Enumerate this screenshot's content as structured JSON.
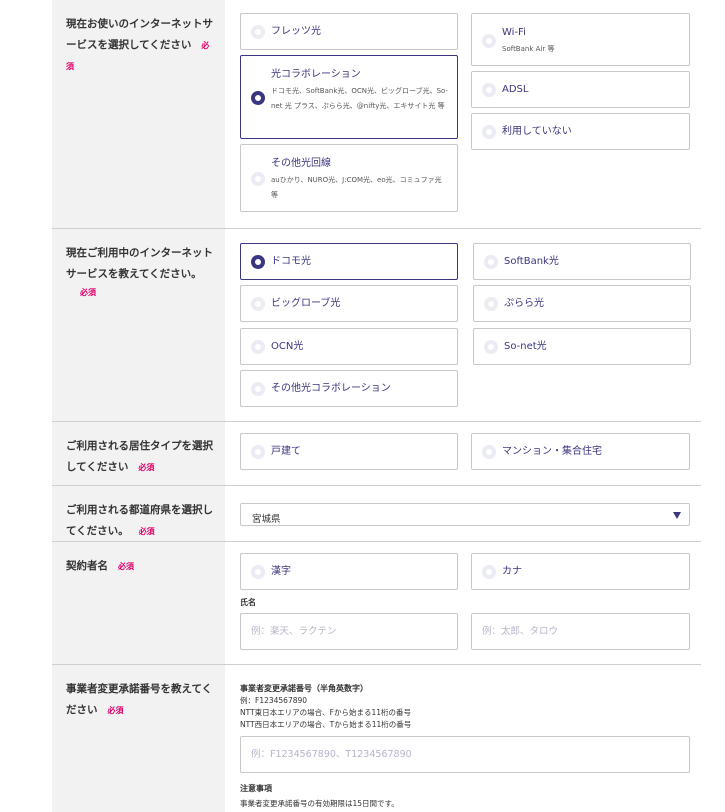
{
  "q1": {
    "label": "現在お使いのインターネットサービスを選択してください",
    "required": "必須",
    "options": [
      {
        "title": "フレッツ光",
        "sub": ""
      },
      {
        "title": "光コラボレーション",
        "sub": "ドコモ光、SoftBank光、OCN光、ビッグローブ光、So-net 光 プラス、ぷらら光、@nifty光、エキサイト光 等"
      },
      {
        "title": "その他光回線",
        "sub": "auひかり、NURO光、J:COM光、eo光、コミュファ光 等"
      },
      {
        "title": "Wi-Fi",
        "sub": "SoftBank Air 等"
      },
      {
        "title": "ADSL",
        "sub": ""
      },
      {
        "title": "利用していない",
        "sub": ""
      }
    ]
  },
  "q2": {
    "label": "現在ご利用中のインターネットサービスを教えてください。",
    "required": "必須",
    "options": [
      "ドコモ光",
      "SoftBank光",
      "ビッグローブ光",
      "ぷらら光",
      "OCN光",
      "So-net光",
      "その他光コラボレーション"
    ]
  },
  "q3": {
    "label": "ご利用される居住タイプを選択してください",
    "required": "必須",
    "options": [
      "戸建て",
      "マンション・集合住宅"
    ]
  },
  "q4": {
    "label": "ご利用される都道府県を選択してください。",
    "required": "必須",
    "selected": "宮城県"
  },
  "q5": {
    "label": "契約者名",
    "required": "必須",
    "options": [
      "漢字",
      "カナ"
    ],
    "name_label": "氏名",
    "last_placeholder": "例：楽天、ラクテン",
    "first_placeholder": "例：太郎、タロウ"
  },
  "q6": {
    "label": "事業者変更承諾番号を教えてください",
    "required": "必須",
    "field_title": "事業者変更承諾番号（半角英数字）",
    "example": "例：F1234567890",
    "note_east": "NTT東日本エリアの場合、Fから始まる11桁の番号",
    "note_west": "NTT西日本エリアの場合、Tから始まる11桁の番号",
    "placeholder": "例：F1234567890、T1234567890",
    "caution_title": "注意事項",
    "caution_text": "事業者変更承諾番号の有効期限は15日間です。"
  }
}
